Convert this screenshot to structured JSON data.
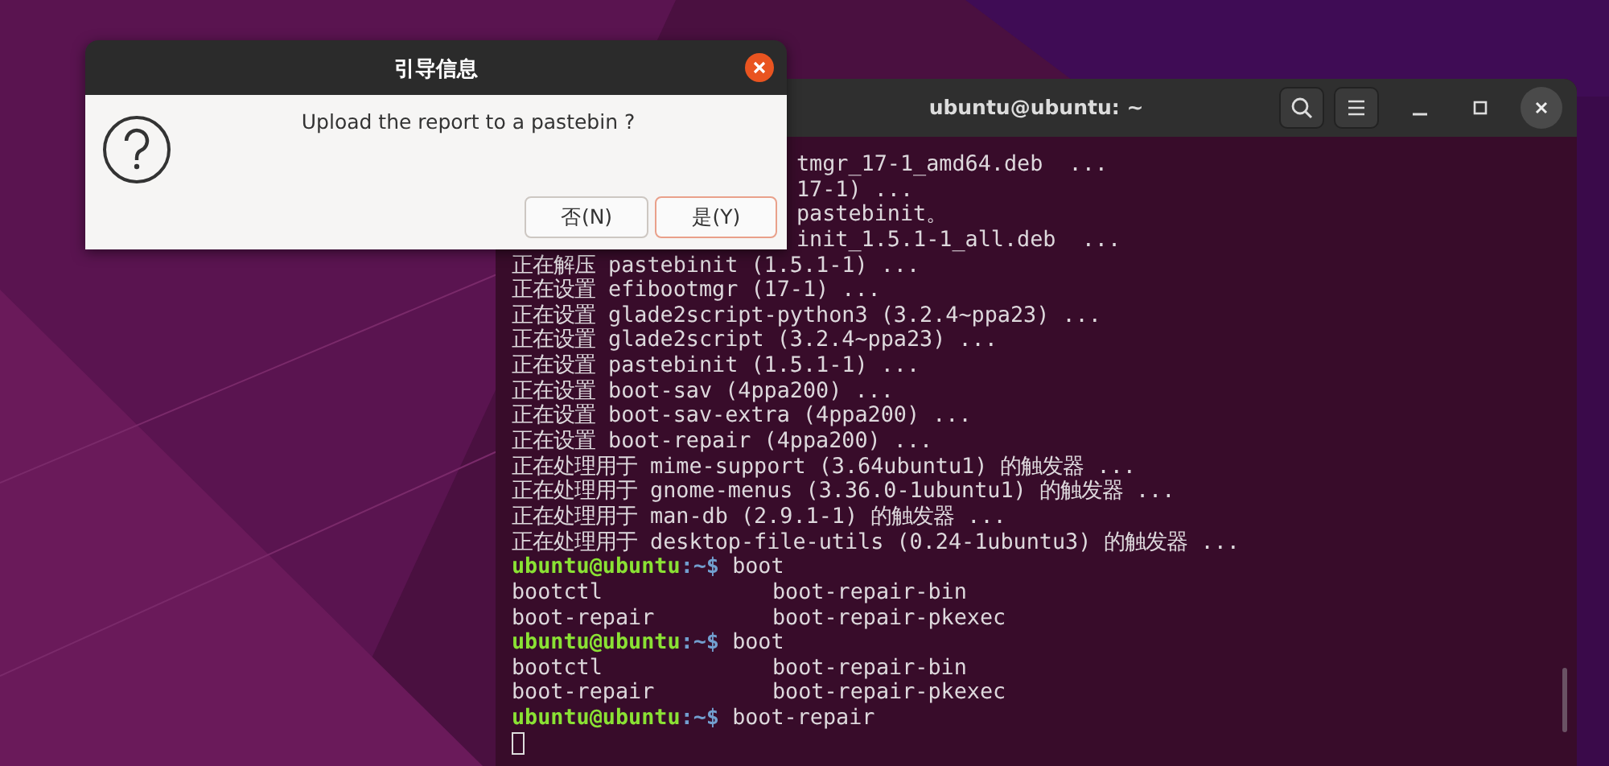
{
  "terminal": {
    "title": "ubuntu@ubuntu: ~",
    "lines": [
      {
        "kind": "clipped",
        "text": "tmgr_17-1_amd64.deb  ..."
      },
      {
        "kind": "clipped",
        "text": "17-1) ..."
      },
      {
        "kind": "clipped",
        "text": "pastebinit。"
      },
      {
        "kind": "clipped",
        "text": "init_1.5.1-1_all.deb  ..."
      },
      {
        "kind": "plain",
        "text": "正在解压 pastebinit (1.5.1-1) ..."
      },
      {
        "kind": "plain",
        "text": "正在设置 efibootmgr (17-1) ..."
      },
      {
        "kind": "plain",
        "text": "正在设置 glade2script-python3 (3.2.4~ppa23) ..."
      },
      {
        "kind": "plain",
        "text": "正在设置 glade2script (3.2.4~ppa23) ..."
      },
      {
        "kind": "plain",
        "text": "正在设置 pastebinit (1.5.1-1) ..."
      },
      {
        "kind": "plain",
        "text": "正在设置 boot-sav (4ppa200) ..."
      },
      {
        "kind": "plain",
        "text": "正在设置 boot-sav-extra (4ppa200) ..."
      },
      {
        "kind": "plain",
        "text": "正在设置 boot-repair (4ppa200) ..."
      },
      {
        "kind": "plain",
        "text": "正在处理用于 mime-support (3.64ubuntu1) 的触发器 ..."
      },
      {
        "kind": "plain",
        "text": "正在处理用于 gnome-menus (3.36.0-1ubuntu1) 的触发器 ..."
      },
      {
        "kind": "plain",
        "text": "正在处理用于 man-db (2.9.1-1) 的触发器 ..."
      },
      {
        "kind": "plain",
        "text": "正在处理用于 desktop-file-utils (0.24-1ubuntu3) 的触发器 ..."
      },
      {
        "kind": "prompt",
        "user": "ubuntu@ubuntu",
        "path": ":~$",
        "command": "boot"
      },
      {
        "kind": "columns",
        "cells": [
          "bootctl",
          "boot-repair-bin"
        ]
      },
      {
        "kind": "columns",
        "cells": [
          "boot-repair",
          "boot-repair-pkexec"
        ]
      },
      {
        "kind": "prompt",
        "user": "ubuntu@ubuntu",
        "path": ":~$",
        "command": "boot"
      },
      {
        "kind": "columns",
        "cells": [
          "bootctl",
          "boot-repair-bin"
        ]
      },
      {
        "kind": "columns",
        "cells": [
          "boot-repair",
          "boot-repair-pkexec"
        ]
      },
      {
        "kind": "prompt",
        "user": "ubuntu@ubuntu",
        "path": ":~$",
        "command": "boot-repair"
      },
      {
        "kind": "cursor"
      }
    ]
  },
  "dialog": {
    "title": "引导信息",
    "message": "Upload the report to a pastebin ?",
    "buttons": [
      {
        "label": "否(N)",
        "focused": false
      },
      {
        "label": "是(Y)",
        "focused": true
      }
    ]
  }
}
